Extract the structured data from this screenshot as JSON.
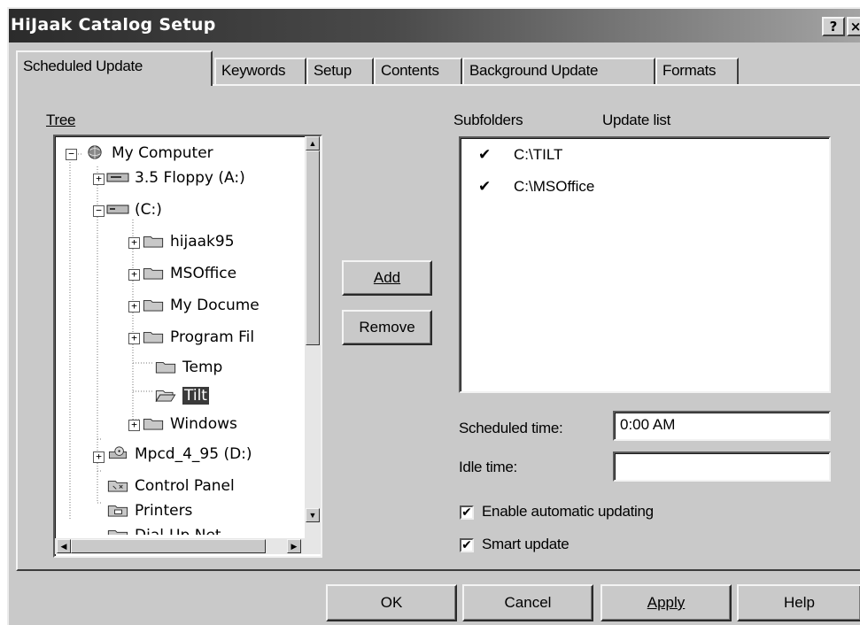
{
  "window": {
    "title": "HiJaak Catalog Setup",
    "help_button": "?",
    "close_button": "×"
  },
  "tabs": [
    {
      "label": "Scheduled Update",
      "active": true
    },
    {
      "label": "Keywords",
      "active": false
    },
    {
      "label": "Setup",
      "active": false
    },
    {
      "label": "Contents",
      "active": false
    },
    {
      "label": "Background Update",
      "active": false
    },
    {
      "label": "Formats",
      "active": false
    }
  ],
  "tree": {
    "label": "Tree",
    "items": [
      {
        "label": "My Computer",
        "icon": "globe-computer-icon",
        "toggle": "−"
      },
      {
        "label": "3.5 Floppy (A:)",
        "icon": "floppy-drive-icon",
        "toggle": "+"
      },
      {
        "label": "(C:)",
        "icon": "hard-drive-icon",
        "toggle": "−"
      },
      {
        "label": "hijaak95",
        "icon": "folder-icon",
        "toggle": "+"
      },
      {
        "label": "MSOffice",
        "icon": "folder-icon",
        "toggle": "+"
      },
      {
        "label": "My Docume",
        "icon": "folder-icon",
        "toggle": "+"
      },
      {
        "label": "Program Fil",
        "icon": "folder-icon",
        "toggle": "+"
      },
      {
        "label": "Temp",
        "icon": "folder-icon",
        "toggle": ""
      },
      {
        "label": "Tilt",
        "icon": "open-folder-icon",
        "toggle": "",
        "selected": true
      },
      {
        "label": "Windows",
        "icon": "folder-icon",
        "toggle": "+"
      },
      {
        "label": "Mpcd_4_95 (D:)",
        "icon": "cd-drive-icon",
        "toggle": "+"
      },
      {
        "label": "Control Panel",
        "icon": "control-panel-icon",
        "toggle": ""
      },
      {
        "label": "Printers",
        "icon": "printer-folder-icon",
        "toggle": ""
      },
      {
        "label": "Dial-Up Net",
        "icon": "network-folder-icon",
        "toggle": ""
      }
    ]
  },
  "buttons": {
    "add": "Add",
    "remove": "Remove"
  },
  "subfolders": {
    "label": "Subfolders",
    "update_list_label": "Update list",
    "items": [
      {
        "check": "✔",
        "path": "C:\\TILT"
      },
      {
        "check": "✔",
        "path": "C:\\MSOffice"
      }
    ]
  },
  "form": {
    "scheduled_time_label": "Scheduled time:",
    "scheduled_time_value": "0:00 AM",
    "idle_time_label": "Idle time:",
    "idle_time_value": "",
    "enable_auto_label": "Enable automatic updating",
    "enable_auto_checked": "✔",
    "smart_update_label": "Smart update",
    "smart_update_checked": "✔"
  },
  "footer": {
    "ok": "OK",
    "cancel": "Cancel",
    "apply": "Apply",
    "help": "Help"
  }
}
